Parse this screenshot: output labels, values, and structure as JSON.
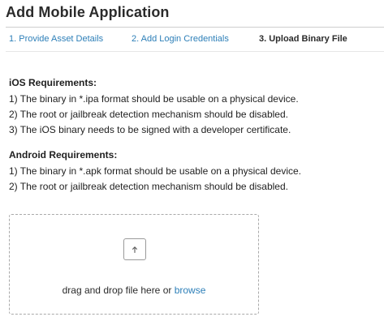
{
  "header": {
    "title": "Add Mobile Application"
  },
  "steps": [
    {
      "label": "1. Provide Asset Details",
      "state": "link"
    },
    {
      "label": "2. Add Login Credentials",
      "state": "link"
    },
    {
      "label": "3. Upload Binary File",
      "state": "active"
    }
  ],
  "ios": {
    "heading": "iOS Requirements:",
    "items": [
      "1) The binary in *.ipa format should be usable on a physical device.",
      "2) The root or jailbreak detection mechanism should be disabled.",
      "3) The iOS binary needs to be signed with a developer certificate."
    ]
  },
  "android": {
    "heading": "Android Requirements:",
    "items": [
      "1) The binary in *.apk format should be usable on a physical device.",
      "2) The root or jailbreak detection mechanism should be disabled."
    ]
  },
  "dropzone": {
    "icon": "arrow-up-icon",
    "text": "drag and drop file here or ",
    "browse_label": "browse"
  },
  "colors": {
    "link": "#2d7fb8",
    "text": "#1f1f1f",
    "border": "#a9a9a9"
  }
}
